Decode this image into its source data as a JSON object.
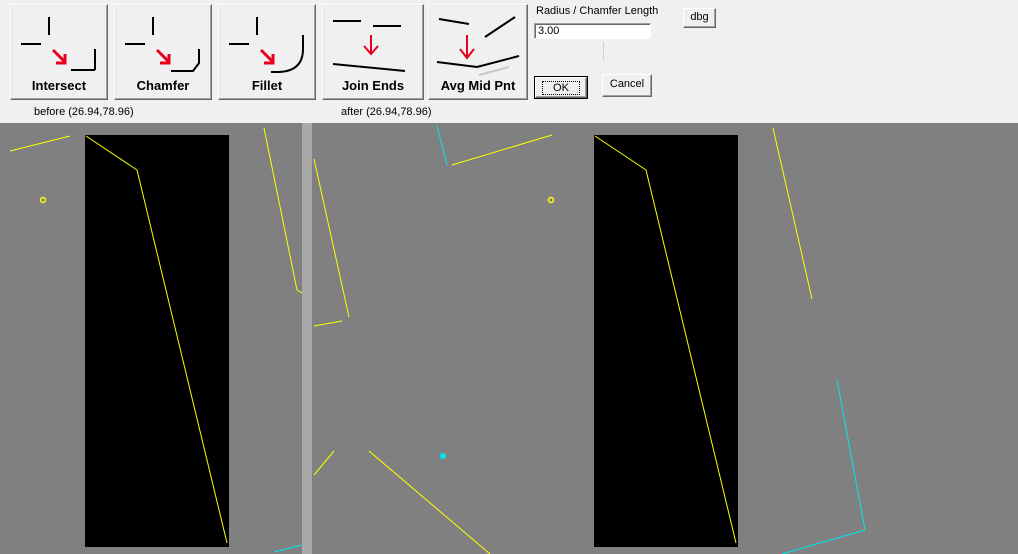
{
  "toolbar": {
    "intersect_label": "Intersect",
    "chamfer_label": "Chamfer",
    "fillet_label": "Fillet",
    "join_ends_label": "Join Ends",
    "avg_mid_label": "Avg Mid Pnt"
  },
  "params": {
    "radius_label": "Radius / Chamfer Length",
    "radius_value": "3.00",
    "ok_label": "OK",
    "cancel_label": "Cancel",
    "dbg_label": "dbg"
  },
  "status": {
    "before_text": "before (26.94,78.96)",
    "after_text": "after (26.94,78.96)"
  },
  "colors": {
    "viewport_bg": "#808080",
    "panel_bg": "#000000",
    "line_yellow": "#ffff00",
    "line_cyan": "#00e5ee",
    "arrow_red": "#e8001c"
  }
}
